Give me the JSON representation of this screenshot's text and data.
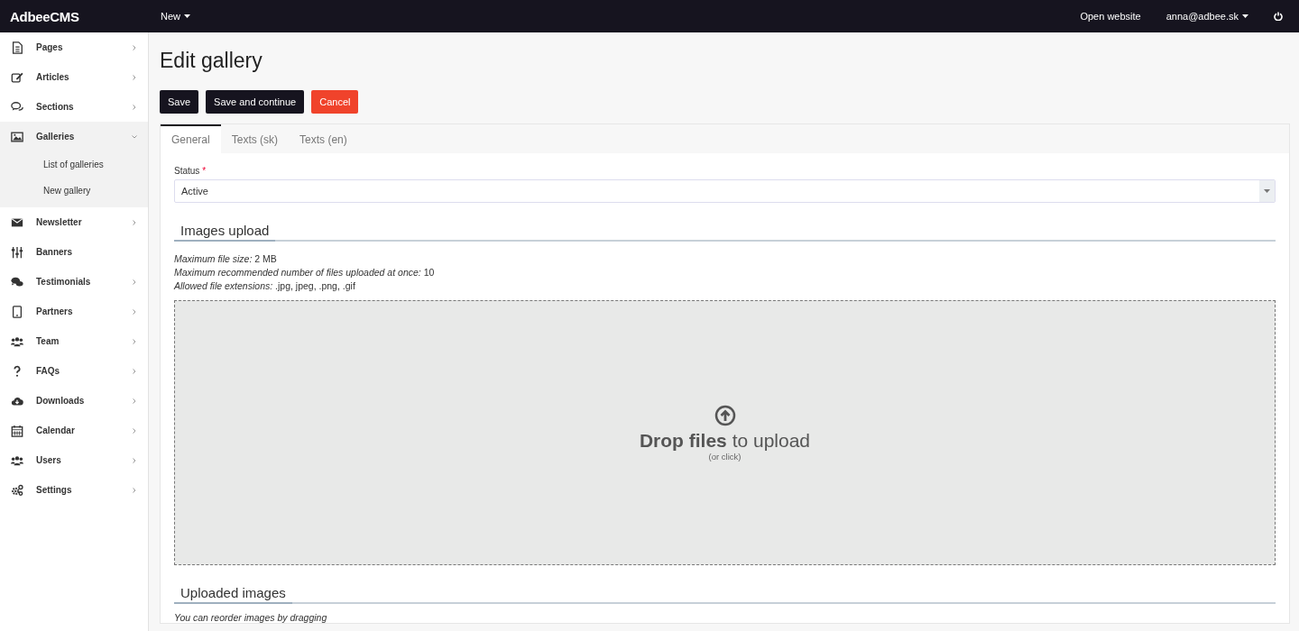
{
  "topbar": {
    "logo": "AdbeeCMS",
    "menu": [
      {
        "label": "New",
        "dropdown": true
      }
    ],
    "right": [
      {
        "label": "Open website",
        "dropdown": false
      },
      {
        "label": "anna@adbee.sk",
        "dropdown": true
      }
    ]
  },
  "sidebar": {
    "items": [
      {
        "label": "Pages",
        "has_submenu": true,
        "expanded": false
      },
      {
        "label": "Articles",
        "has_submenu": true,
        "expanded": false
      },
      {
        "label": "Sections",
        "has_submenu": true,
        "expanded": false
      },
      {
        "label": "Galleries",
        "has_submenu": true,
        "expanded": true,
        "children": [
          {
            "label": "List of galleries"
          },
          {
            "label": "New gallery"
          }
        ]
      },
      {
        "label": "Newsletter",
        "has_submenu": true,
        "expanded": false
      },
      {
        "label": "Banners",
        "has_submenu": false,
        "expanded": false
      },
      {
        "label": "Testimonials",
        "has_submenu": true,
        "expanded": false
      },
      {
        "label": "Partners",
        "has_submenu": true,
        "expanded": false
      },
      {
        "label": "Team",
        "has_submenu": true,
        "expanded": false
      },
      {
        "label": "FAQs",
        "has_submenu": true,
        "expanded": false
      },
      {
        "label": "Downloads",
        "has_submenu": true,
        "expanded": false
      },
      {
        "label": "Calendar",
        "has_submenu": true,
        "expanded": false
      },
      {
        "label": "Users",
        "has_submenu": true,
        "expanded": false
      },
      {
        "label": "Settings",
        "has_submenu": true,
        "expanded": false
      }
    ]
  },
  "page": {
    "title": "Edit gallery",
    "buttons": [
      {
        "label": "Save",
        "kind": "primary"
      },
      {
        "label": "Save and continue",
        "kind": "primary"
      },
      {
        "label": "Cancel",
        "kind": "danger"
      }
    ],
    "tabs": [
      {
        "label": "General",
        "selected": true
      },
      {
        "label": "Texts (sk)",
        "selected": false
      },
      {
        "label": "Texts (en)",
        "selected": false
      }
    ],
    "status_field": {
      "label": "Status",
      "required_mark": "*",
      "value": "Active"
    },
    "images_upload": {
      "heading": "Images upload",
      "info": [
        "*Maximum file size:* 2 MB",
        "*Maximum recommended number of files uploaded at once:* 10",
        "*Allowed file extensions:* .jpg, jpeg, .png, .gif"
      ],
      "dropzone": {
        "title": "**Drop files** to upload",
        "hint": "(or click)"
      }
    },
    "uploaded_images": {
      "heading": "Uploaded images",
      "note": "You can reorder images by dragging"
    }
  }
}
